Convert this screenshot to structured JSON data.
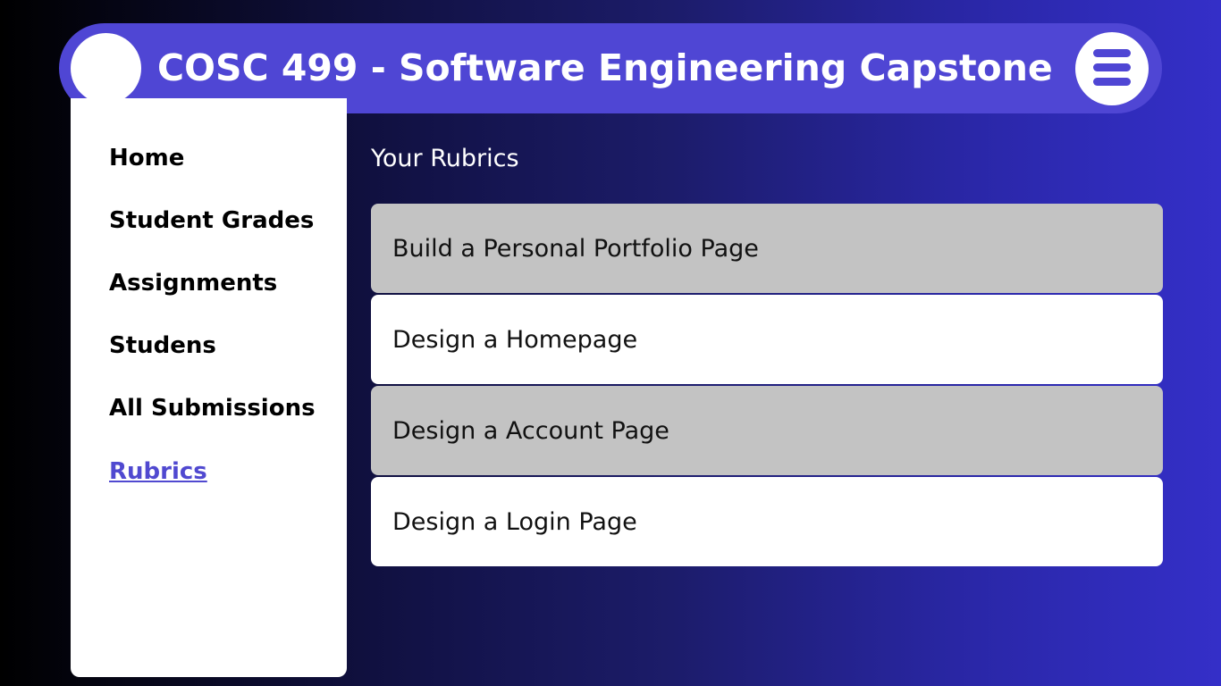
{
  "header": {
    "title": "COSC 499 - Software Engineering Capstone",
    "menu_icon": "hamburger-menu-icon"
  },
  "sidebar": {
    "items": [
      {
        "label": "Home",
        "active": false
      },
      {
        "label": "Student Grades",
        "active": false
      },
      {
        "label": "Assignments",
        "active": false
      },
      {
        "label": "Studens",
        "active": false
      },
      {
        "label": "All Submissions",
        "active": false
      },
      {
        "label": "Rubrics",
        "active": true
      }
    ]
  },
  "main": {
    "section_title": "Your Rubrics",
    "rubrics": [
      {
        "label": "Build a Personal Portfolio Page"
      },
      {
        "label": "Design a Homepage"
      },
      {
        "label": "Design a Account Page"
      },
      {
        "label": "Design a Login Page"
      }
    ]
  },
  "colors": {
    "accent": "#4f46d4",
    "active_link": "#5049d0",
    "rubric_alt": "#c3c3c3",
    "rubric_base": "#ffffff"
  }
}
